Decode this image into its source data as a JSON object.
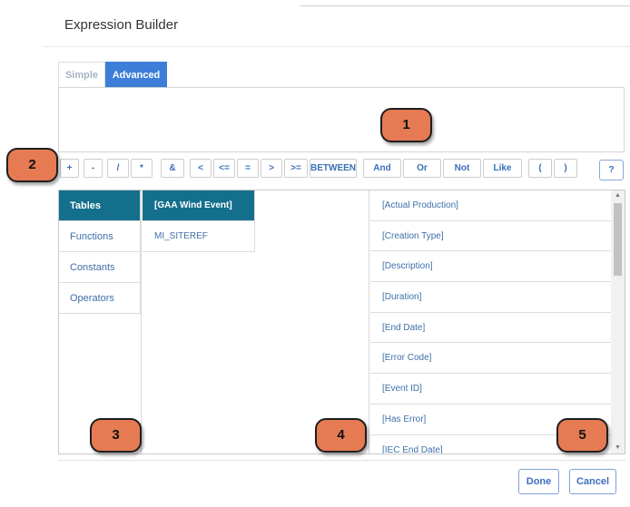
{
  "dialog": {
    "title": "Expression Builder"
  },
  "tabs": [
    {
      "label": "Simple",
      "active": false
    },
    {
      "label": "Advanced",
      "active": true
    }
  ],
  "operators": [
    "+",
    "-",
    "/",
    "*",
    "&",
    "<",
    "<=",
    "=",
    ">",
    ">=",
    "BETWEEN",
    "And",
    "Or",
    "Not",
    "Like",
    "(",
    ")"
  ],
  "help_button": "?",
  "categories": [
    {
      "label": "Tables",
      "selected": true
    },
    {
      "label": "Functions",
      "selected": false
    },
    {
      "label": "Constants",
      "selected": false
    },
    {
      "label": "Operators",
      "selected": false
    }
  ],
  "tables": [
    {
      "label": "[GAA Wind Event]",
      "selected": true
    },
    {
      "label": "MI_SITEREF",
      "selected": false
    }
  ],
  "fields": [
    "[Actual Production]",
    "[Creation Type]",
    "[Description]",
    "[Duration]",
    "[End Date]",
    "[Error Code]",
    "[Event ID]",
    "[Has Error]",
    "[IEC End Date]"
  ],
  "footer": {
    "done": "Done",
    "cancel": "Cancel"
  },
  "callouts": [
    "1",
    "2",
    "3",
    "4",
    "5"
  ],
  "colors": {
    "accent": "#3d7fd8",
    "selected": "#146f8c",
    "callout": "#e57a53",
    "link": "#3d6fa8"
  }
}
